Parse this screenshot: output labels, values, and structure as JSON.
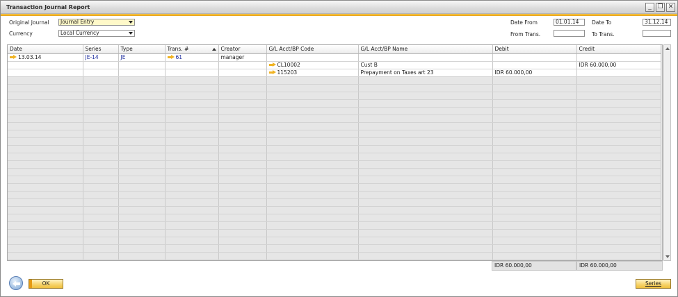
{
  "window": {
    "title": "Transaction Journal Report"
  },
  "filters": {
    "original_journal_label": "Original Journal",
    "original_journal_value": "Journal Entry",
    "currency_label": "Currency",
    "currency_value": "Local Currency",
    "date_from_label": "Date From",
    "date_from_value": "01.01.14",
    "date_to_label": "Date To",
    "date_to_value": "31.12.14",
    "from_trans_label": "From Trans.",
    "from_trans_value": "",
    "to_trans_label": "To Trans.",
    "to_trans_value": ""
  },
  "grid": {
    "columns": [
      "Date",
      "Series",
      "Type",
      "Trans. #",
      "Creator",
      "G/L Acct/BP Code",
      "G/L Acct/BP Name",
      "Debit",
      "Credit"
    ],
    "rows": [
      {
        "date": "13.03.14",
        "series": "JE-14",
        "type": "JE",
        "trans": "61",
        "creator": "manager",
        "code": "",
        "name": "",
        "debit": "",
        "credit": ""
      },
      {
        "date": "",
        "series": "",
        "type": "",
        "trans": "",
        "creator": "",
        "code": "CL10002",
        "name": "Cust B",
        "debit": "",
        "credit": "IDR 60.000,00"
      },
      {
        "date": "",
        "series": "",
        "type": "",
        "trans": "",
        "creator": "",
        "code": "115203",
        "name": "Prepayment on Taxes art 23",
        "debit": "IDR 60.000,00",
        "credit": ""
      }
    ],
    "totals": {
      "debit": "IDR 60.000,00",
      "credit": "IDR 60.000,00"
    }
  },
  "buttons": {
    "ok": "OK",
    "series": "Series"
  },
  "colors": {
    "accent": "#f0b323",
    "field_highlight": "#fff9c9",
    "link": "#1f2f9e"
  }
}
